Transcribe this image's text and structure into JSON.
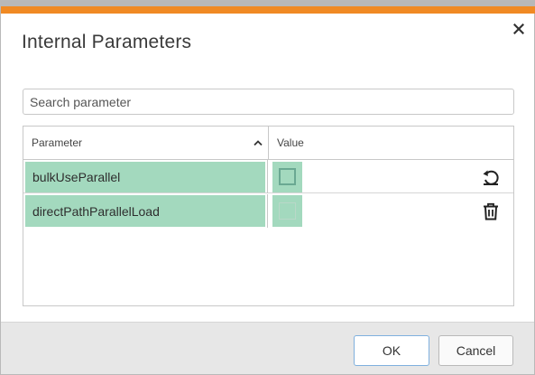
{
  "dialog": {
    "title": "Internal Parameters",
    "close_icon": "close-icon",
    "accent_color": "#f08a24"
  },
  "search": {
    "placeholder": "Search parameter",
    "value": ""
  },
  "table": {
    "columns": [
      {
        "label": "Parameter",
        "sort": "ascending"
      },
      {
        "label": "Value"
      }
    ],
    "rows": [
      {
        "name": "bulkUseParallel",
        "value": false,
        "action_icon": "reset-icon"
      },
      {
        "name": "directPathParallelLoad",
        "value": false,
        "action_icon": "trash-icon"
      }
    ],
    "highlight_color": "#a3d9be"
  },
  "footer": {
    "ok_label": "OK",
    "cancel_label": "Cancel"
  }
}
